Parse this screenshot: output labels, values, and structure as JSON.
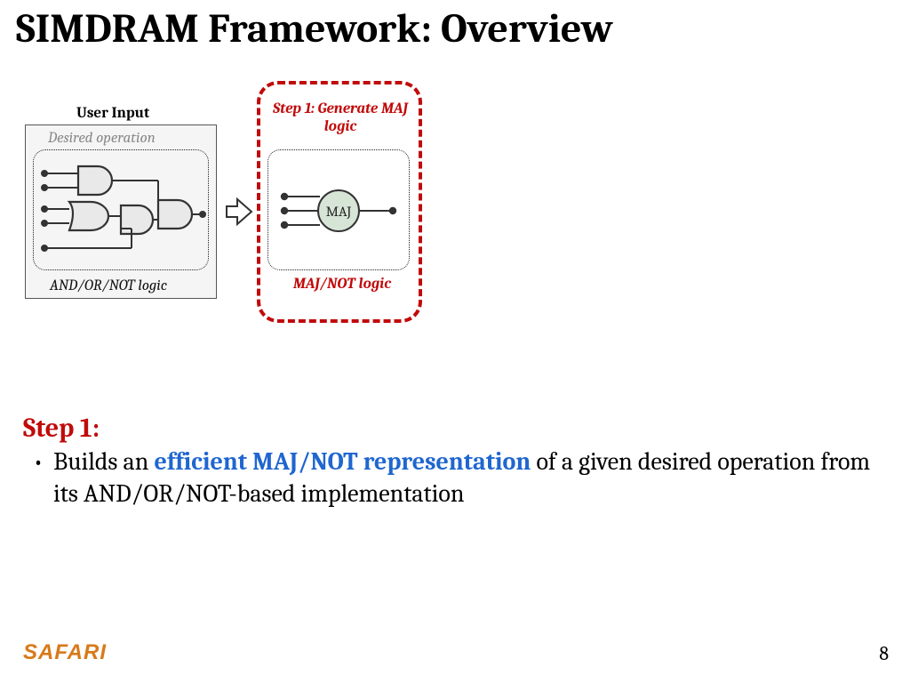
{
  "title": "SIMDRAM Framework: Overview",
  "user_input": {
    "label": "User Input",
    "desired_op": "Desired operation",
    "bottom": "AND/OR/NOT logic"
  },
  "step1_box": {
    "title": "Step 1: Generate MAJ logic",
    "maj": "MAJ",
    "bottom": "MAJ/NOT logic"
  },
  "step1_heading": "Step 1:",
  "body": {
    "prefix": "Builds an ",
    "highlight": "efficient MAJ/NOT representation",
    "suffix": " of a given desired operation from its AND/OR/NOT-based implementation"
  },
  "logo": "SAFARI",
  "page": "8"
}
